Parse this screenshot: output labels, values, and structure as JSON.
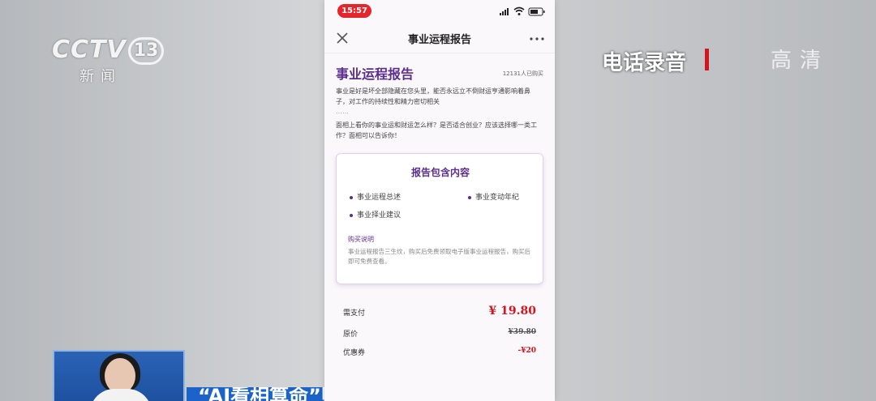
{
  "broadcast": {
    "channel_logo": "CCTV",
    "channel_number": "13",
    "channel_subtitle": "新闻",
    "recording_label": "电话录音",
    "hd_label": "高清",
    "ticker_text": "“AI看相算命”账号：运营者",
    "accent_red": "#d4141e",
    "ticker_blue": "#1b63c8"
  },
  "phone": {
    "status_time": "15:57",
    "nav_title": "事业运程报告",
    "report_title": "事业运程报告",
    "buyers_count": "12131人已购买",
    "intro_text": "事业是好是坏全部隐藏在您头里，能否永远立不倒财运亨通影响着鼻子，对工作的持续性和精力密切相关",
    "ellipsis": "……",
    "question_text": "面相上看你的事业运和财运怎么样？是否适合创业？应该选择哪一类工作？面相可以告诉你！",
    "card": {
      "title": "报告包含内容",
      "items": [
        "事业运程总述",
        "事业变动年纪",
        "事业择业建议"
      ],
      "purchase_heading": "购买说明",
      "purchase_note": "事业运程报告三生纹，购买后免费领取电子版事业运程报告，购买后即可免费查看。"
    },
    "pricing": {
      "pay_label": "需支付",
      "pay_value": "¥ 19.80",
      "original_label": "原价",
      "original_value": "¥39.80",
      "coupon_label": "优惠券",
      "coupon_value": "-¥20"
    },
    "brand_purple": "#5b2e8c"
  }
}
